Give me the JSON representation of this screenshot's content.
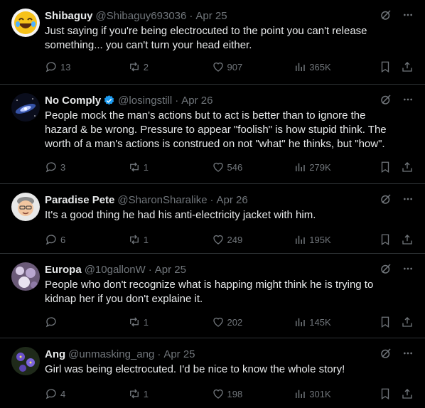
{
  "tweets": [
    {
      "name": "Shibaguy",
      "handle": "@Shibaguy693036",
      "sep": "·",
      "date": "Apr 25",
      "verified": false,
      "text": "Just saying if you're being electrocuted to the point you can't release something... you can't turn your head either.",
      "replies": "13",
      "retweets": "2",
      "likes": "907",
      "views": "365K",
      "avatar": "laughing-emoji"
    },
    {
      "name": "No Comply",
      "handle": "@losingstill",
      "sep": "·",
      "date": "Apr 26",
      "verified": true,
      "text": "People mock the man's actions but to act is better than to ignore the hazard & be wrong. Pressure to appear \"foolish\" is how stupid think. The worth of a man's actions is construed on not \"what\" he thinks, but \"how\".",
      "replies": "3",
      "retweets": "1",
      "likes": "546",
      "views": "279K",
      "avatar": "galaxy"
    },
    {
      "name": "Paradise Pete",
      "handle": "@SharonSharalike",
      "sep": "·",
      "date": "Apr 26",
      "verified": false,
      "text": "It's a good thing he had his anti-electricity jacket with him.",
      "replies": "6",
      "retweets": "1",
      "likes": "249",
      "views": "195K",
      "avatar": "memoji"
    },
    {
      "name": "Europa",
      "handle": "@10gallonW",
      "sep": "·",
      "date": "Apr 25",
      "verified": false,
      "text": "People who don't recognize what is happing might think he is trying to kidnap her if you don't explaine it.",
      "replies": "",
      "retweets": "1",
      "likes": "202",
      "views": "145K",
      "avatar": "flowers-purple"
    },
    {
      "name": "Ang",
      "handle": "@unmasking_ang",
      "sep": "·",
      "date": "Apr 25",
      "verified": false,
      "text": "Girl was being electrocuted. I'd be nice to know the whole story!",
      "replies": "4",
      "retweets": "1",
      "likes": "198",
      "views": "301K",
      "avatar": "violets"
    }
  ],
  "colors": {
    "bg": "#000000",
    "text": "#e7e9ea",
    "muted": "#71767b",
    "verified": "#1d9bf0",
    "border": "#2f3336"
  }
}
